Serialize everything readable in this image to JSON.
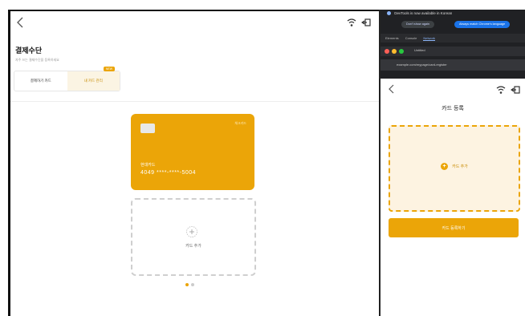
{
  "left_app": {
    "title": "결제수단",
    "subtitle": "자주 쓰는 결제수단을 등록하세요",
    "tabs": [
      {
        "label": "결제하기 카드"
      },
      {
        "label": "내 카드 관리"
      }
    ],
    "new_badge": "NEW",
    "card": {
      "top_label": "체크카드",
      "name": "현대카드",
      "number": "4049 ****-****-5004"
    },
    "add_card_label": "카드 추가"
  },
  "devtools": {
    "info": "DevTools is now available in Korean",
    "btn_dont_show": "Don't show again",
    "btn_switch": "Always match Chrome's language",
    "tabs": [
      "Elements",
      "Console",
      "Network"
    ],
    "window_title": "Untitled",
    "url": "example.com/mypage/card-register"
  },
  "right_app": {
    "title": "카드 등록",
    "add_card_label": "카드 추가",
    "register_button": "카드 등록하기"
  },
  "colors": {
    "accent": "#eba508",
    "accent_light": "#fdf3e1"
  }
}
